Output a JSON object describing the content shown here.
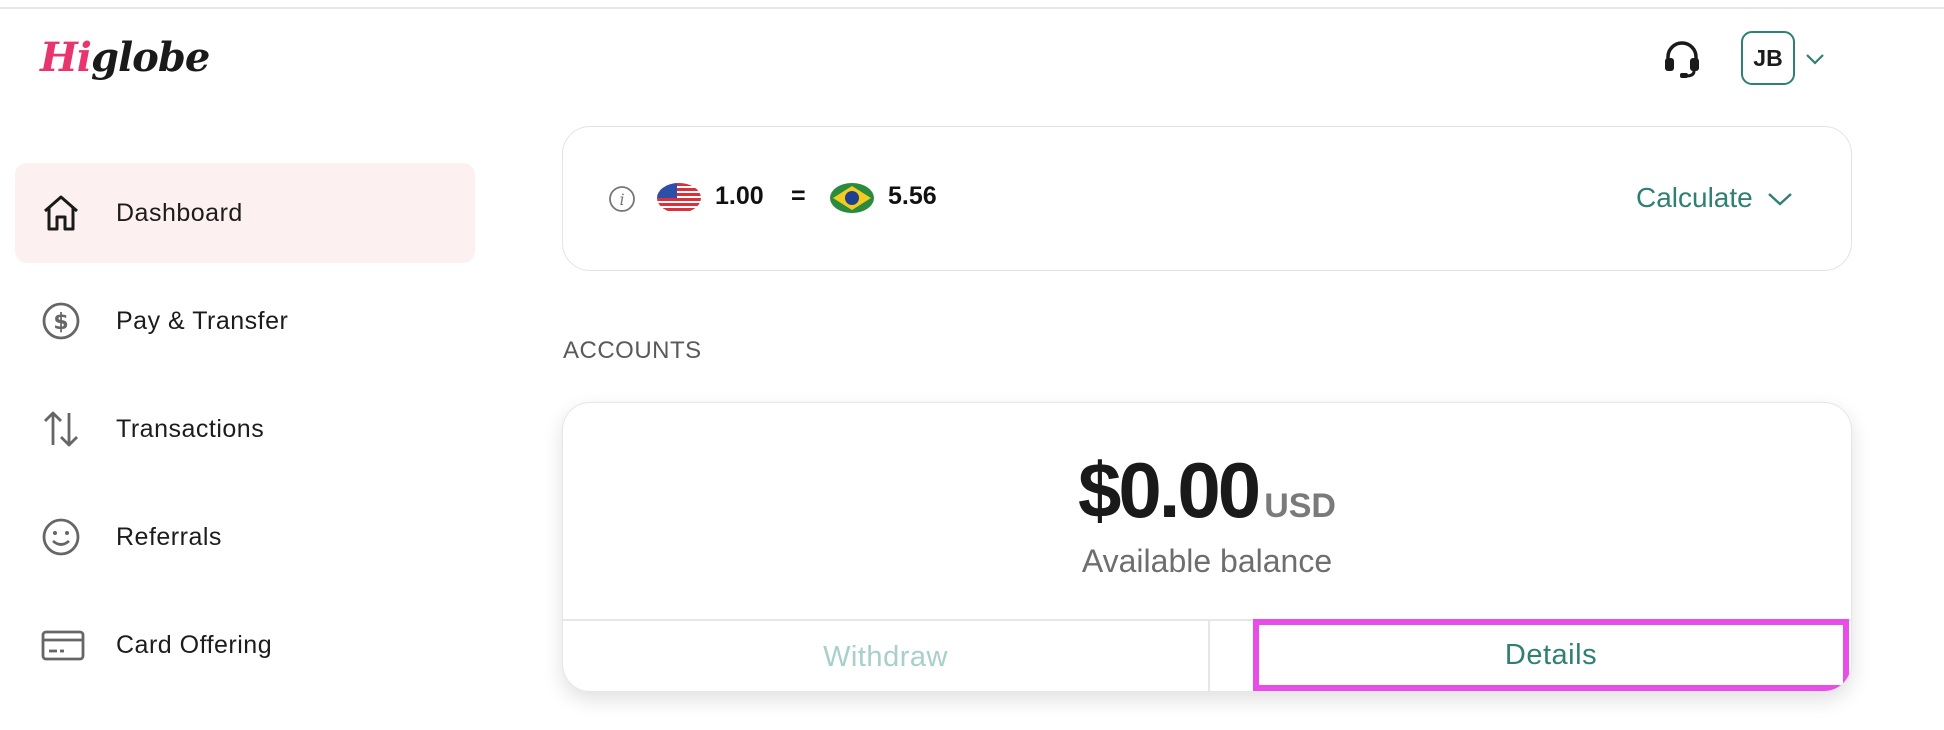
{
  "brand": {
    "logo_hi": "Hi",
    "logo_rest": "globe"
  },
  "header": {
    "avatar_initials": "JB"
  },
  "sidebar": {
    "items": [
      {
        "label": "Dashboard",
        "icon": "home-icon",
        "active": true
      },
      {
        "label": "Pay & Transfer",
        "icon": "dollar-circle-icon",
        "active": false
      },
      {
        "label": "Transactions",
        "icon": "arrows-up-down-icon",
        "active": false
      },
      {
        "label": "Referrals",
        "icon": "smiley-icon",
        "active": false
      },
      {
        "label": "Card Offering",
        "icon": "credit-card-icon",
        "active": false
      }
    ]
  },
  "rate": {
    "from_amount": "1.00",
    "equals": "=",
    "to_amount": "5.56",
    "from_flag": "us-flag-icon",
    "to_flag": "brazil-flag-icon",
    "calculate_label": "Calculate"
  },
  "accounts": {
    "title": "ACCOUNTS",
    "balance_amount": "$0.00",
    "balance_currency": "USD",
    "balance_label": "Available balance",
    "withdraw_label": "Withdraw",
    "details_label": "Details"
  },
  "colors": {
    "accent": "#2f7f74",
    "brand_pink": "#e8356d",
    "active_nav_bg": "#fcf0f0",
    "highlight": "#e84de8",
    "disabled_text": "#a7cfcb"
  }
}
